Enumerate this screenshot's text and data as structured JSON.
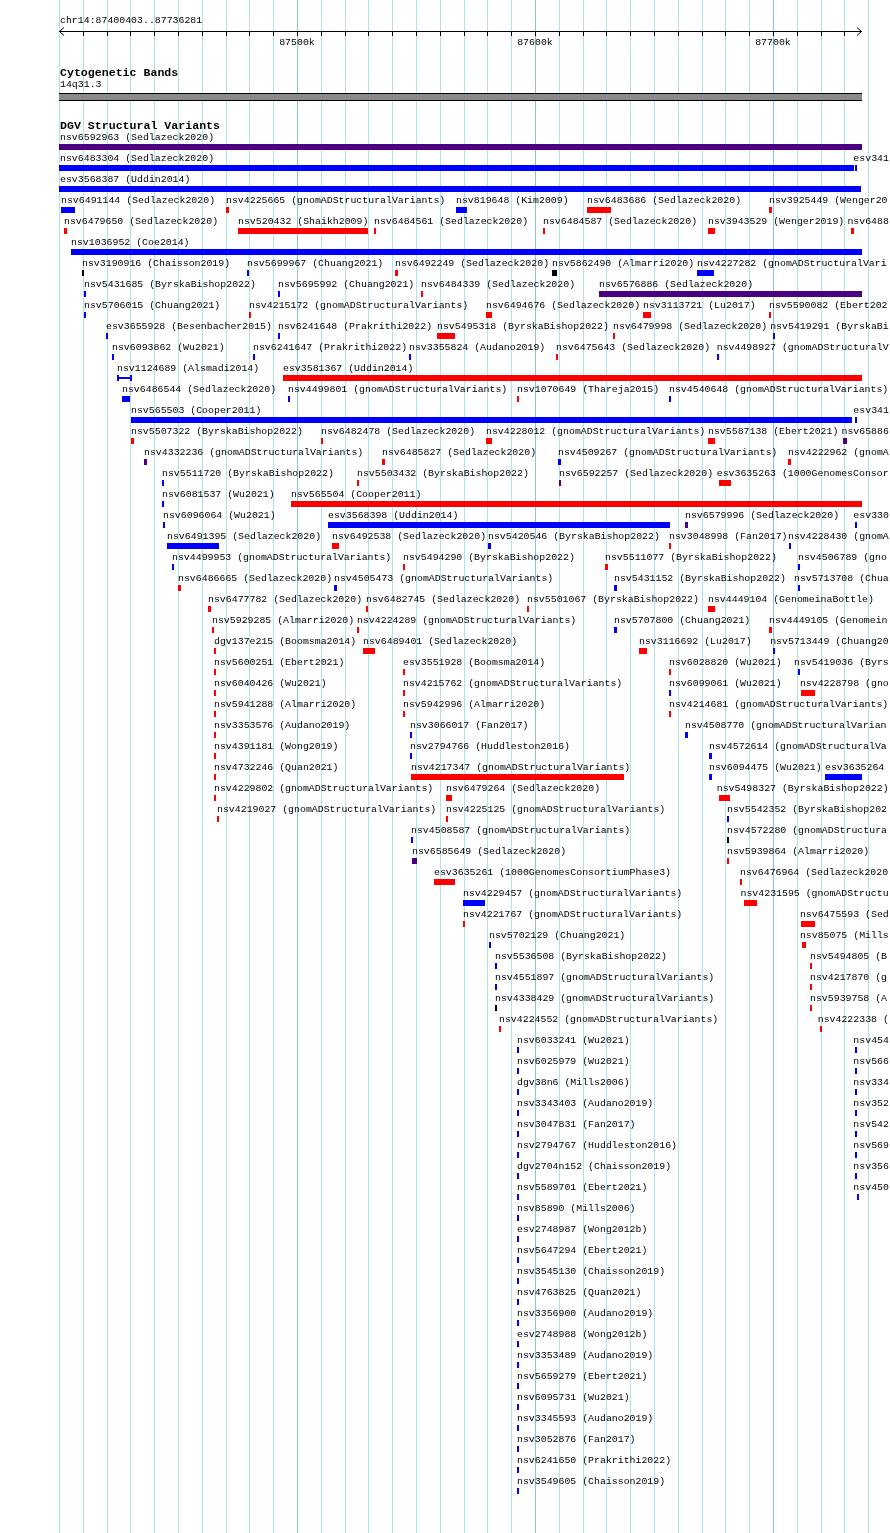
{
  "location": "chr14:87400403..87736281",
  "ruler": {
    "ticks": [
      "87500k",
      "87600k",
      "87700k"
    ]
  },
  "tracks": [
    {
      "kind": "bands",
      "title": "Cytogenetic Bands",
      "bands": [
        {
          "label": "14q31.3"
        }
      ]
    },
    {
      "kind": "features",
      "title": "DGV Structural Variants",
      "rows": [
        {
          "features": [
            {
              "label": "nsv6592963 (Sedlazeck2020)",
              "color": "#4b0082",
              "kind": "block"
            }
          ]
        },
        {
          "features": [
            {
              "label": "nsv6483304 (Sedlazeck2020)",
              "color": "#0000ff",
              "kind": "block"
            },
            {
              "label": "esv341",
              "color": "#0000ff",
              "kind": "block"
            }
          ]
        },
        {
          "features": [
            {
              "label": "esv3568387 (Uddin2014)",
              "color": "#0000ff",
              "kind": "block"
            }
          ]
        },
        {
          "features": [
            {
              "label": "nsv6491144 (Sedlazeck2020)",
              "color": "#0000ff",
              "kind": "block"
            },
            {
              "label": "nsv4225665 (gnomADStructuralVariants)",
              "color": "#ff0000",
              "kind": "block"
            },
            {
              "label": "nsv819648 (Kim2009)",
              "color": "#0000ff",
              "kind": "block"
            },
            {
              "label": "nsv6483686 (Sedlazeck2020)",
              "color": "#ff0000",
              "kind": "block"
            },
            {
              "label": "nsv3925449 (Wenger20",
              "color": "#ff0000",
              "kind": "block"
            }
          ]
        },
        {
          "features": [
            {
              "label": "nsv6479650 (Sedlazeck2020)",
              "color": "#ff0000",
              "kind": "block"
            },
            {
              "label": "nsv520432 (Shaikh2009)",
              "color": "#ff0000",
              "kind": "block"
            },
            {
              "label": "nsv6484561 (Sedlazeck2020)",
              "color": "#ff0000",
              "kind": "block"
            },
            {
              "label": "nsv6484587 (Sedlazeck2020)",
              "color": "#ff0000",
              "kind": "block"
            },
            {
              "label": "nsv3943529 (Wenger2019)",
              "color": "#ff0000",
              "kind": "block"
            },
            {
              "label": "nsv6488",
              "color": "#ff0000",
              "kind": "block"
            }
          ]
        },
        {
          "features": [
            {
              "label": "nsv1036952 (Coe2014)",
              "color": "#0000ff",
              "kind": "block"
            }
          ]
        },
        {
          "features": [
            {
              "label": "nsv3190916 (Chaisson2019)",
              "color": "#000000",
              "kind": "block"
            },
            {
              "label": "nsv5699967 (Chuang2021)",
              "color": "#0000ff",
              "kind": "block"
            },
            {
              "label": "nsv6492249 (Sedlazeck2020)",
              "color": "#ff0000",
              "kind": "block"
            },
            {
              "label": "nsv5862490 (Almarri2020)",
              "color": "#000000",
              "kind": "block"
            },
            {
              "label": "nsv4227282 (gnomADStructuralVari",
              "color": "#0000ff",
              "kind": "block"
            }
          ]
        },
        {
          "features": [
            {
              "label": "nsv5431685 (ByrskaBishop2022)",
              "color": "#0000ff",
              "kind": "block"
            },
            {
              "label": "nsv5695992 (Chuang2021)",
              "color": "#0000ff",
              "kind": "block"
            },
            {
              "label": "nsv6484339 (Sedlazeck2020)",
              "color": "#ff0000",
              "kind": "block"
            },
            {
              "label": "nsv6576886 (Sedlazeck2020)",
              "color": "#4b0082",
              "kind": "block"
            }
          ]
        },
        {
          "features": [
            {
              "label": "nsv5706015 (Chuang2021)",
              "color": "#0000ff",
              "kind": "block"
            },
            {
              "label": "nsv4215172 (gnomADStructuralVariants)",
              "color": "#ff0000",
              "kind": "block"
            },
            {
              "label": "nsv6494676 (Sedlazeck2020)",
              "color": "#ff0000",
              "kind": "block"
            },
            {
              "label": "nsv3113721 (Lu2017)",
              "color": "#ff0000",
              "kind": "block"
            },
            {
              "label": "nsv5590082 (Ebert202",
              "color": "#ff0000",
              "kind": "block"
            }
          ]
        },
        {
          "features": [
            {
              "label": "esv3655928 (Besenbacher2015)",
              "color": "#0000ff",
              "kind": "block"
            },
            {
              "label": "nsv6241648 (Prakrithi2022)",
              "color": "#0000ff",
              "kind": "block"
            },
            {
              "label": "nsv5495318 (ByrskaBishop2022)",
              "color": "#ff0000",
              "kind": "block"
            },
            {
              "label": "nsv6479998 (Sedlazeck2020)",
              "color": "#ff0000",
              "kind": "block"
            },
            {
              "label": "nsv5419291 (ByrskaBi",
              "color": "#0000ff",
              "kind": "block"
            }
          ]
        },
        {
          "features": [
            {
              "label": "nsv6093862 (Wu2021)",
              "color": "#0000ff",
              "kind": "block"
            },
            {
              "label": "nsv6241647 (Prakrithi2022)",
              "color": "#0000ff",
              "kind": "block"
            },
            {
              "label": "nsv3355824 (Audano2019)",
              "color": "#0000ff",
              "kind": "block"
            },
            {
              "label": "nsv6475643 (Sedlazeck2020)",
              "color": "#ff0000",
              "kind": "block"
            },
            {
              "label": "nsv4498927 (gnomADStructuralV",
              "color": "#0000ff",
              "kind": "block"
            }
          ]
        },
        {
          "features": [
            {
              "label": "nsv1124689 (Alsmadi2014)",
              "color": "#0000ff",
              "kind": "span"
            },
            {
              "label": "esv3581367 (Uddin2014)",
              "color": "#ff0000",
              "kind": "block"
            }
          ]
        },
        {
          "features": [
            {
              "label": "nsv6486544 (Sedlazeck2020)",
              "color": "#0000ff",
              "kind": "block"
            },
            {
              "label": "nsv4499801 (gnomADStructuralVariants)",
              "color": "#0000ff",
              "kind": "block"
            },
            {
              "label": "nsv1070649 (Thareja2015)",
              "color": "#ff0000",
              "kind": "block"
            },
            {
              "label": "nsv4540648 (gnomADStructuralVariants)",
              "color": "#0000ff",
              "kind": "block"
            }
          ]
        },
        {
          "features": [
            {
              "label": "nsv565503 (Cooper2011)",
              "color": "#0000ff",
              "kind": "block"
            },
            {
              "label": "esv341",
              "color": "#0000ff",
              "kind": "block"
            }
          ]
        },
        {
          "features": [
            {
              "label": "nsv5507322 (ByrskaBishop2022)",
              "color": "#ff0000",
              "kind": "block"
            },
            {
              "label": "nsv6482478 (Sedlazeck2020)",
              "color": "#ff0000",
              "kind": "block"
            },
            {
              "label": "nsv4228012 (gnomADStructuralVariants)",
              "color": "#ff0000",
              "kind": "block"
            },
            {
              "label": "nsv5587138 (Ebert2021)",
              "color": "#ff0000",
              "kind": "block"
            },
            {
              "label": "nsv65886",
              "color": "#4b0082",
              "kind": "block"
            }
          ]
        },
        {
          "features": [
            {
              "label": "nsv4332236 (gnomADStructuralVariants)",
              "color": "#4b0082",
              "kind": "block"
            },
            {
              "label": "nsv6485827 (Sedlazeck2020)",
              "color": "#ff0000",
              "kind": "block"
            },
            {
              "label": "nsv4509267 (gnomADStructuralVariants)",
              "color": "#0000ff",
              "kind": "block"
            },
            {
              "label": "nsv4222962 (gnomA",
              "color": "#ff0000",
              "kind": "block"
            }
          ]
        },
        {
          "features": [
            {
              "label": "nsv5511720 (ByrskaBishop2022)",
              "color": "#0000ff",
              "kind": "block"
            },
            {
              "label": "nsv5503432 (ByrskaBishop2022)",
              "color": "#ff0000",
              "kind": "block"
            },
            {
              "label": "nsv6592257 (Sedlazeck2020)",
              "color": "#4b0082",
              "kind": "block"
            },
            {
              "label": "esv3635263 (1000GenomesConsor",
              "color": "#ff0000",
              "kind": "block"
            }
          ]
        },
        {
          "features": [
            {
              "label": "nsv6081537 (Wu2021)",
              "color": "#0000ff",
              "kind": "block"
            },
            {
              "label": "nsv565504 (Cooper2011)",
              "color": "#ff0000",
              "kind": "block"
            }
          ]
        },
        {
          "features": [
            {
              "label": "nsv6096064 (Wu2021)",
              "color": "#0000ff",
              "kind": "block"
            },
            {
              "label": "esv3568398 (Uddin2014)",
              "color": "#0000ff",
              "kind": "block"
            },
            {
              "label": "nsv6579996 (Sedlazeck2020)",
              "color": "#4b0082",
              "kind": "block"
            },
            {
              "label": "esv330",
              "color": "#0000ff",
              "kind": "block"
            }
          ]
        },
        {
          "features": [
            {
              "label": "nsv6491395 (Sedlazeck2020)",
              "color": "#0000ff",
              "kind": "block"
            },
            {
              "label": "nsv6492538 (Sedlazeck2020)",
              "color": "#ff0000",
              "kind": "block"
            },
            {
              "label": "nsv5420546 (ByrskaBishop2022)",
              "color": "#0000ff",
              "kind": "block"
            },
            {
              "label": "nsv3048998 (Fan2017)",
              "color": "#ff0000",
              "kind": "block"
            },
            {
              "label": "nsv4228430 (gnomA",
              "color": "#0000ff",
              "kind": "block"
            }
          ]
        },
        {
          "features": [
            {
              "label": "nsv4499953 (gnomADStructuralVariants)",
              "color": "#0000ff",
              "kind": "block"
            },
            {
              "label": "nsv5494290 (ByrskaBishop2022)",
              "color": "#ff0000",
              "kind": "block"
            },
            {
              "label": "nsv5511077 (ByrskaBishop2022)",
              "color": "#ff0000",
              "kind": "block"
            },
            {
              "label": "nsv4506789 (gno",
              "color": "#0000ff",
              "kind": "block"
            }
          ]
        },
        {
          "features": [
            {
              "label": "nsv6486665 (Sedlazeck2020)",
              "color": "#ff0000",
              "kind": "block"
            },
            {
              "label": "nsv4505473 (gnomADStructuralVariants)",
              "color": "#0000ff",
              "kind": "block"
            },
            {
              "label": "nsv5431152 (ByrskaBishop2022)",
              "color": "#0000ff",
              "kind": "block"
            },
            {
              "label": "nsv5713708 (Chua",
              "color": "#0000ff",
              "kind": "block"
            }
          ]
        },
        {
          "features": [
            {
              "label": "nsv6477782 (Sedlazeck2020)",
              "color": "#ff0000",
              "kind": "block"
            },
            {
              "label": "nsv6482745 (Sedlazeck2020)",
              "color": "#ff0000",
              "kind": "block"
            },
            {
              "label": "nsv5501067 (ByrskaBishop2022)",
              "color": "#ff0000",
              "kind": "block"
            },
            {
              "label": "nsv4449104 (GenomeinaBottle)",
              "color": "#ff0000",
              "kind": "block"
            }
          ]
        },
        {
          "features": [
            {
              "label": "nsv5929285 (Almarri2020)",
              "color": "#ff0000",
              "kind": "block"
            },
            {
              "label": "nsv4224289 (gnomADStructuralVariants)",
              "color": "#ff0000",
              "kind": "block"
            },
            {
              "label": "nsv5707800 (Chuang2021)",
              "color": "#0000ff",
              "kind": "block"
            },
            {
              "label": "nsv4449105 (Genomein",
              "color": "#ff0000",
              "kind": "block"
            }
          ]
        },
        {
          "features": [
            {
              "label": "dgv137e215 (Boomsma2014)",
              "color": "#ff0000",
              "kind": "block"
            },
            {
              "label": "nsv6489401 (Sedlazeck2020)",
              "color": "#ff0000",
              "kind": "block"
            },
            {
              "label": "nsv3116692 (Lu2017)",
              "color": "#ff0000",
              "kind": "block"
            },
            {
              "label": "nsv5713449 (Chuang20",
              "color": "#0000ff",
              "kind": "block"
            }
          ]
        },
        {
          "features": [
            {
              "label": "nsv5600251 (Ebert2021)",
              "color": "#ff0000",
              "kind": "block"
            },
            {
              "label": "esv3551928 (Boomsma2014)",
              "color": "#ff0000",
              "kind": "block"
            },
            {
              "label": "nsv6028820 (Wu2021)",
              "color": "#ff0000",
              "kind": "block"
            },
            {
              "label": "nsv5419036 (Byrs",
              "color": "#0000ff",
              "kind": "block"
            }
          ]
        },
        {
          "features": [
            {
              "label": "nsv6040426 (Wu2021)",
              "color": "#ff0000",
              "kind": "block"
            },
            {
              "label": "nsv4215762 (gnomADStructuralVariants)",
              "color": "#ff0000",
              "kind": "block"
            },
            {
              "label": "nsv6099061 (Wu2021)",
              "color": "#0000ff",
              "kind": "block"
            },
            {
              "label": "nsv4228798 (gno",
              "color": "#ff0000",
              "kind": "block"
            }
          ]
        },
        {
          "features": [
            {
              "label": "nsv5941288 (Almarri2020)",
              "color": "#ff0000",
              "kind": "block"
            },
            {
              "label": "nsv5942996 (Almarri2020)",
              "color": "#ff0000",
              "kind": "block"
            },
            {
              "label": "nsv4214681 (gnomADStructuralVariants)",
              "color": "#ff0000",
              "kind": "block"
            }
          ]
        },
        {
          "features": [
            {
              "label": "nsv3353576 (Audano2019)",
              "color": "#ff0000",
              "kind": "block"
            },
            {
              "label": "nsv3066017 (Fan2017)",
              "color": "#0000ff",
              "kind": "block"
            },
            {
              "label": "nsv4508770 (gnomADStructuralVarian",
              "color": "#0000ff",
              "kind": "block"
            }
          ]
        },
        {
          "features": [
            {
              "label": "nsv4391181 (Wong2019)",
              "color": "#ff0000",
              "kind": "block"
            },
            {
              "label": "nsv2794766 (Huddleston2016)",
              "color": "#0000ff",
              "kind": "block"
            },
            {
              "label": "nsv4572614 (gnomADStructuralVa",
              "color": "#0000ff",
              "kind": "block"
            }
          ]
        },
        {
          "features": [
            {
              "label": "nsv4732246 (Quan2021)",
              "color": "#ff0000",
              "kind": "block"
            },
            {
              "label": "nsv4217347 (gnomADStructuralVariants)",
              "color": "#ff0000",
              "kind": "block"
            },
            {
              "label": "nsv6094475 (Wu2021)",
              "color": "#0000ff",
              "kind": "block"
            },
            {
              "label": "esv3635264",
              "color": "#0000ff",
              "kind": "block"
            }
          ]
        },
        {
          "features": [
            {
              "label": "nsv4229802 (gnomADStructuralVariants)",
              "color": "#ff0000",
              "kind": "block"
            },
            {
              "label": "nsv6479264 (Sedlazeck2020)",
              "color": "#ff0000",
              "kind": "block"
            },
            {
              "label": "nsv5498327 (ByrskaBishop2022)",
              "color": "#ff0000",
              "kind": "block"
            }
          ]
        },
        {
          "features": [
            {
              "label": "nsv4219027 (gnomADStructuralVariants)",
              "color": "#ff0000",
              "kind": "block"
            },
            {
              "label": "nsv4225125 (gnomADStructuralVariants)",
              "color": "#ff0000",
              "kind": "block"
            },
            {
              "label": "nsv5542352 (ByrskaBishop202",
              "color": "#0000ff",
              "kind": "block"
            }
          ]
        },
        {
          "features": [
            {
              "label": "nsv4508587 (gnomADStructuralVariants)",
              "color": "#0000ff",
              "kind": "block"
            },
            {
              "label": "nsv4572280 (gnomADStructura",
              "color": "#000000",
              "kind": "block"
            }
          ]
        },
        {
          "features": [
            {
              "label": "nsv6585649 (Sedlazeck2020)",
              "color": "#4b0082",
              "kind": "block"
            },
            {
              "label": "nsv5939864 (Almarri2020)",
              "color": "#ff0000",
              "kind": "block"
            }
          ]
        },
        {
          "features": [
            {
              "label": "esv3635261 (1000GenomesConsortiumPhase3)",
              "color": "#ff0000",
              "kind": "block"
            },
            {
              "label": "nsv6476964 (Sedlazeck2020",
              "color": "#ff0000",
              "kind": "block"
            }
          ]
        },
        {
          "features": [
            {
              "label": "nsv4229457 (gnomADStructuralVariants)",
              "color": "#0000ff",
              "kind": "block"
            },
            {
              "label": "nsv4231595 (gnomADStructu",
              "color": "#ff0000",
              "kind": "block"
            }
          ]
        },
        {
          "features": [
            {
              "label": "nsv4221767 (gnomADStructuralVariants)",
              "color": "#ff0000",
              "kind": "block"
            },
            {
              "label": "nsv6475593 (Sed",
              "color": "#ff0000",
              "kind": "block"
            }
          ]
        },
        {
          "features": [
            {
              "label": "nsv5702129 (Chuang2021)",
              "color": "#0000ff",
              "kind": "block"
            },
            {
              "label": "nsv85075 (Mills",
              "color": "#ff0000",
              "kind": "block"
            }
          ]
        },
        {
          "features": [
            {
              "label": "nsv5536508 (ByrskaBishop2022)",
              "color": "#0000ff",
              "kind": "block"
            },
            {
              "label": "nsv5494805 (B",
              "color": "#ff0000",
              "kind": "block"
            }
          ]
        },
        {
          "features": [
            {
              "label": "nsv4551897 (gnomADStructuralVariants)",
              "color": "#0000ff",
              "kind": "block"
            },
            {
              "label": "nsv4217870 (g",
              "color": "#ff0000",
              "kind": "block"
            }
          ]
        },
        {
          "features": [
            {
              "label": "nsv4338429 (gnomADStructuralVariants)",
              "color": "#000000",
              "kind": "block"
            },
            {
              "label": "nsv5939758 (A",
              "color": "#ff0000",
              "kind": "block"
            }
          ]
        },
        {
          "features": [
            {
              "label": "nsv4224552 (gnomADStructuralVariants)",
              "color": "#ff0000",
              "kind": "block"
            },
            {
              "label": "nsv4222338 (",
              "color": "#ff0000",
              "kind": "block"
            }
          ]
        },
        {
          "features": [
            {
              "label": "nsv6033241 (Wu2021)",
              "color": "#0000ff",
              "kind": "block"
            },
            {
              "label": "nsv454",
              "color": "#0000ff",
              "kind": "block"
            }
          ]
        },
        {
          "features": [
            {
              "label": "nsv6025979 (Wu2021)",
              "color": "#0000ff",
              "kind": "block"
            },
            {
              "label": "nsv566",
              "color": "#0000ff",
              "kind": "block"
            }
          ]
        },
        {
          "features": [
            {
              "label": "dgv38n6 (Mills2006)",
              "color": "#0000ff",
              "kind": "block"
            },
            {
              "label": "nsv334",
              "color": "#0000ff",
              "kind": "block"
            }
          ]
        },
        {
          "features": [
            {
              "label": "nsv3343403 (Audano2019)",
              "color": "#0000ff",
              "kind": "block"
            },
            {
              "label": "nsv352",
              "color": "#0000ff",
              "kind": "block"
            }
          ]
        },
        {
          "features": [
            {
              "label": "nsv3047831 (Fan2017)",
              "color": "#0000ff",
              "kind": "block"
            },
            {
              "label": "nsv542",
              "color": "#0000ff",
              "kind": "block"
            }
          ]
        },
        {
          "features": [
            {
              "label": "nsv2794767 (Huddleston2016)",
              "color": "#0000ff",
              "kind": "block"
            },
            {
              "label": "nsv569",
              "color": "#0000ff",
              "kind": "block"
            }
          ]
        },
        {
          "features": [
            {
              "label": "dgv2704n152 (Chaisson2019)",
              "color": "#0000ff",
              "kind": "block"
            },
            {
              "label": "nsv356",
              "color": "#0000ff",
              "kind": "block"
            }
          ]
        },
        {
          "features": [
            {
              "label": "nsv5589701 (Ebert2021)",
              "color": "#0000ff",
              "kind": "block"
            },
            {
              "label": "nsv450",
              "color": "#0000ff",
              "kind": "block"
            }
          ]
        },
        {
          "features": [
            {
              "label": "nsv85890 (Mills2006)",
              "color": "#0000ff",
              "kind": "block"
            }
          ]
        },
        {
          "features": [
            {
              "label": "esv2748987 (Wong2012b)",
              "color": "#0000ff",
              "kind": "block"
            }
          ]
        },
        {
          "features": [
            {
              "label": "nsv5647294 (Ebert2021)",
              "color": "#0000ff",
              "kind": "block"
            }
          ]
        },
        {
          "features": [
            {
              "label": "nsv3545130 (Chaisson2019)",
              "color": "#0000ff",
              "kind": "block"
            }
          ]
        },
        {
          "features": [
            {
              "label": "nsv4763825 (Quan2021)",
              "color": "#0000ff",
              "kind": "block"
            }
          ]
        },
        {
          "features": [
            {
              "label": "nsv3356900 (Audano2019)",
              "color": "#0000ff",
              "kind": "block"
            }
          ]
        },
        {
          "features": [
            {
              "label": "esv2748988 (Wong2012b)",
              "color": "#0000ff",
              "kind": "block"
            }
          ]
        },
        {
          "features": [
            {
              "label": "nsv3353489 (Audano2019)",
              "color": "#0000ff",
              "kind": "block"
            }
          ]
        },
        {
          "features": [
            {
              "label": "nsv5659279 (Ebert2021)",
              "color": "#0000ff",
              "kind": "block"
            }
          ]
        },
        {
          "features": [
            {
              "label": "nsv6095731 (Wu2021)",
              "color": "#0000ff",
              "kind": "block"
            }
          ]
        },
        {
          "features": [
            {
              "label": "nsv3345593 (Audano2019)",
              "color": "#0000ff",
              "kind": "block"
            }
          ]
        },
        {
          "features": [
            {
              "label": "nsv3052876 (Fan2017)",
              "color": "#0000ff",
              "kind": "block"
            }
          ]
        },
        {
          "features": [
            {
              "label": "nsv6241650 (Prakrithi2022)",
              "color": "#0000ff",
              "kind": "block"
            }
          ]
        },
        {
          "features": [
            {
              "label": "nsv3549605 (Chaisson2019)",
              "color": "#0000ff",
              "kind": "block"
            }
          ]
        }
      ]
    }
  ]
}
